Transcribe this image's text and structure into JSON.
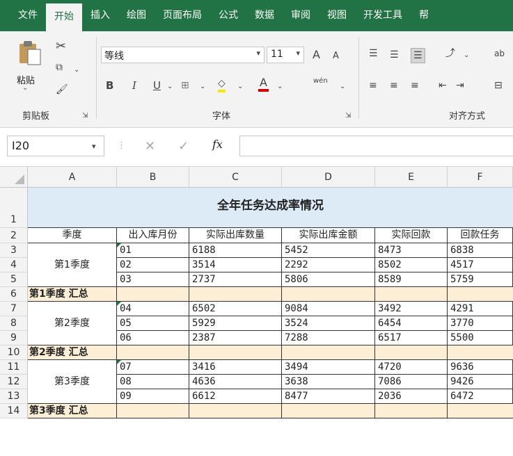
{
  "tabs": [
    "文件",
    "开始",
    "插入",
    "绘图",
    "页面布局",
    "公式",
    "数据",
    "审阅",
    "视图",
    "开发工具",
    "帮"
  ],
  "ribbon": {
    "paste_label": "粘贴",
    "clipboard_label": "剪贴板",
    "font_name": "等线",
    "font_size": "11",
    "font_label": "字体",
    "align_label": "对齐方式",
    "bold": "B",
    "italic": "I",
    "underline": "U",
    "font_color": "A",
    "grow": "A",
    "shrink": "A",
    "phonetic": "wén",
    "wrap": "ab"
  },
  "formula_bar": {
    "name_box": "I20",
    "fx": "fx",
    "formula": ""
  },
  "columns": [
    "A",
    "B",
    "C",
    "D",
    "E",
    "F"
  ],
  "rows": [
    "1",
    "2",
    "3",
    "4",
    "5",
    "6",
    "7",
    "8",
    "9",
    "10",
    "11",
    "12",
    "13",
    "14"
  ],
  "sheet": {
    "title": "全年任务达成率情况",
    "headers": [
      "季度",
      "出入库月份",
      "实际出库数量",
      "实际出库金额",
      "实际回款",
      "回款任务"
    ],
    "quarters": [
      "第1季度",
      "第2季度",
      "第3季度"
    ],
    "data": [
      [
        "01",
        "6188",
        "5452",
        "8473",
        "6838"
      ],
      [
        "02",
        "3514",
        "2292",
        "8502",
        "4517"
      ],
      [
        "03",
        "2737",
        "5806",
        "8589",
        "5759"
      ],
      [
        "04",
        "6502",
        "9084",
        "3492",
        "4291"
      ],
      [
        "05",
        "5929",
        "3524",
        "6454",
        "3770"
      ],
      [
        "06",
        "2387",
        "7288",
        "6517",
        "5500"
      ],
      [
        "07",
        "3416",
        "3494",
        "4720",
        "9636"
      ],
      [
        "08",
        "4636",
        "3638",
        "7086",
        "9426"
      ],
      [
        "09",
        "6612",
        "8477",
        "2036",
        "6472"
      ]
    ],
    "subtotals": [
      "第1季度 汇总",
      "第2季度 汇总",
      "第3季度 汇总"
    ]
  },
  "colors": {
    "accent": "#217346",
    "title_fill": "#ddebf7",
    "subtotal_fill": "#fdefd6",
    "flag": "#1e7b3c"
  }
}
